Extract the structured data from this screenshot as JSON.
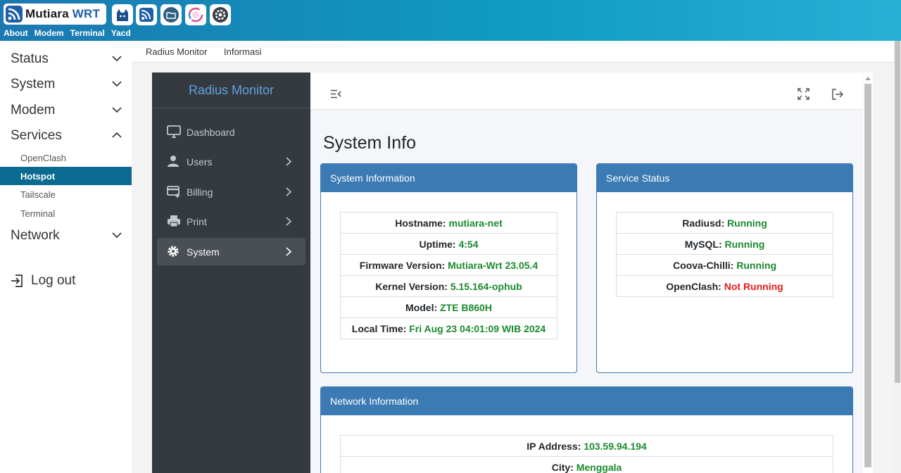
{
  "header": {
    "brand_main": "Mutiara ",
    "brand_accent": "WRT",
    "links": [
      "About",
      "Modem",
      "Terminal",
      "Yacd"
    ],
    "app_icons": [
      "openclash-cat-icon",
      "rss-feed-icon",
      "folder-icon",
      "monitor-ring-icon",
      "settings-icon"
    ]
  },
  "sidebar": {
    "groups": [
      {
        "label": "Status",
        "expanded": false
      },
      {
        "label": "System",
        "expanded": false
      },
      {
        "label": "Modem",
        "expanded": false
      },
      {
        "label": "Services",
        "expanded": true
      },
      {
        "label": "Network",
        "expanded": false
      }
    ],
    "services_items": [
      "OpenClash",
      "Hotspot",
      "Tailscale",
      "Terminal"
    ],
    "active_item": "Hotspot",
    "logout_label": "Log out"
  },
  "tabs": [
    "Radius Monitor",
    "Informasi"
  ],
  "app": {
    "title": "Radius Monitor",
    "menu": [
      {
        "label": "Dashboard",
        "icon": "desktop-icon",
        "submenu": false
      },
      {
        "label": "Users",
        "icon": "user-icon",
        "submenu": true
      },
      {
        "label": "Billing",
        "icon": "billing-icon",
        "submenu": true
      },
      {
        "label": "Print",
        "icon": "printer-icon",
        "submenu": true
      },
      {
        "label": "System",
        "icon": "gear-icon",
        "submenu": true
      }
    ],
    "active_menu": "System",
    "page_title": "System Info",
    "system_info": {
      "title": "System Information",
      "rows": [
        {
          "label": "Hostname:",
          "value": "mutiara-net"
        },
        {
          "label": "Uptime:",
          "value": "4:54"
        },
        {
          "label": "Firmware Version:",
          "value": "Mutiara-Wrt 23.05.4"
        },
        {
          "label": "Kernel Version:",
          "value": "5.15.164-ophub"
        },
        {
          "label": "Model:",
          "value": "ZTE B860H"
        },
        {
          "label": "Local Time:",
          "value": "Fri Aug 23 04:01:09 WIB 2024"
        }
      ]
    },
    "service_status": {
      "title": "Service Status",
      "rows": [
        {
          "label": "Radiusd:",
          "value": "Running",
          "status": "ok"
        },
        {
          "label": "MySQL:",
          "value": "Running",
          "status": "ok"
        },
        {
          "label": "Coova-Chilli:",
          "value": "Running",
          "status": "ok"
        },
        {
          "label": "OpenClash:",
          "value": "Not Running",
          "status": "bad"
        }
      ]
    },
    "network_info": {
      "title": "Network Information",
      "rows": [
        {
          "label": "IP Address:",
          "value": "103.59.94.194"
        },
        {
          "label": "City:",
          "value": "Menggala"
        }
      ]
    }
  },
  "colors": {
    "header_gradient_start": "#1c78b0",
    "header_gradient_end": "#27b0d6",
    "sidebar_active": "#0b6a90",
    "card_accent": "#3c7ab4",
    "status_ok": "#1a8a2e",
    "status_bad": "#e01b1b"
  }
}
